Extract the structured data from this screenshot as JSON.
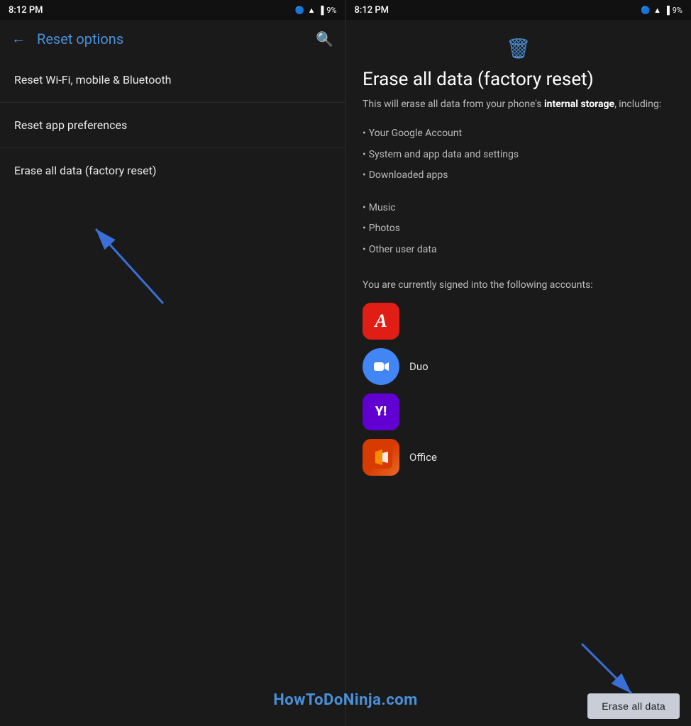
{
  "status": {
    "left": {
      "time": "8:12 PM",
      "battery": "9%"
    },
    "right": {
      "time": "8:12 PM",
      "battery": "9%"
    }
  },
  "left_panel": {
    "title": "Reset options",
    "back_label": "←",
    "search_label": "🔍",
    "menu_items": [
      {
        "label": "Reset Wi-Fi, mobile & Bluetooth"
      },
      {
        "label": "Reset app preferences"
      },
      {
        "label": "Erase all data (factory reset)"
      }
    ]
  },
  "right_panel": {
    "title": "Erase all data (factory reset)",
    "description_plain": "This will erase all data from your phone's ",
    "description_bold": "internal storage",
    "description_end": ", including:",
    "bullets_main": [
      "Your Google Account",
      "System and app data and settings",
      "Downloaded apps"
    ],
    "bullets_secondary": [
      "Music",
      "Photos",
      "Other user data"
    ],
    "accounts_text": "You are currently signed into the following accounts:",
    "accounts": [
      {
        "name": "Adobe",
        "label": ""
      },
      {
        "name": "Duo",
        "label": "Duo"
      },
      {
        "name": "Yahoo",
        "label": ""
      },
      {
        "name": "Office",
        "label": "Office"
      }
    ],
    "erase_button": "Erase all data"
  },
  "watermark": "HowToDoNinja.com"
}
